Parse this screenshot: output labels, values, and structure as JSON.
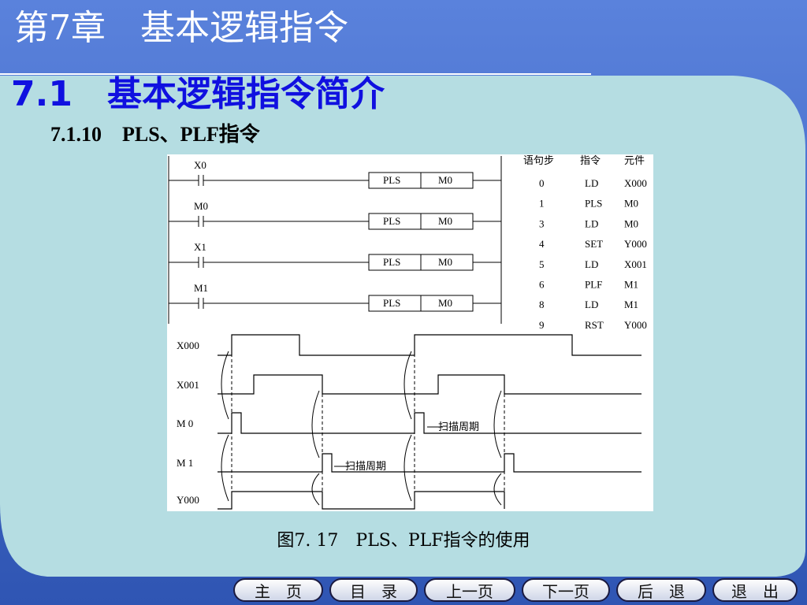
{
  "header": {
    "chapter_title": "第7章　基本逻辑指令",
    "section_title": "7.1　基本逻辑指令简介",
    "subsection_title": "7.1.10　PLS、PLF指令"
  },
  "ladder": {
    "rungs": [
      {
        "contact": "X0",
        "instruction": "PLS",
        "operand": "M0"
      },
      {
        "contact": "M0",
        "instruction": "PLS",
        "operand": "M0"
      },
      {
        "contact": "X1",
        "instruction": "PLS",
        "operand": "M0"
      },
      {
        "contact": "M1",
        "instruction": "PLS",
        "operand": "M0"
      }
    ]
  },
  "program_table": {
    "headers": [
      "语句步",
      "指令",
      "元件"
    ],
    "rows": [
      [
        "0",
        "LD",
        "X000"
      ],
      [
        "1",
        "PLS",
        "M0"
      ],
      [
        "3",
        "LD",
        "M0"
      ],
      [
        "4",
        "SET",
        "Y000"
      ],
      [
        "5",
        "LD",
        "X001"
      ],
      [
        "6",
        "PLF",
        "M1"
      ],
      [
        "8",
        "LD",
        "M1"
      ],
      [
        "9",
        "RST",
        "Y000"
      ]
    ]
  },
  "timing": {
    "signals": [
      "X000",
      "X001",
      "M  0",
      "M  1",
      "Y000"
    ],
    "scan_label": "扫描周期"
  },
  "caption": "图7. 17　PLS、PLF指令的使用",
  "nav": {
    "home": "主　页",
    "contents": "目　录",
    "prev": "上一页",
    "next": "下一页",
    "back": "后　退",
    "exit": "退　出"
  },
  "colors": {
    "header_blue": "#3d63c0",
    "content_bg": "#b5dde2",
    "section_blue": "#1010e0"
  }
}
